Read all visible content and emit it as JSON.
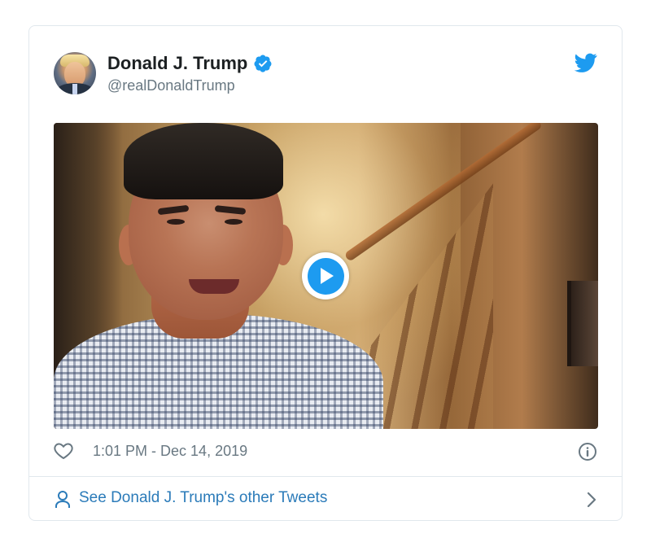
{
  "tweet": {
    "author": {
      "display_name": "Donald J. Trump",
      "handle": "@realDonaldTrump",
      "verified": true,
      "avatar_icon": "profile-photo"
    },
    "timestamp": "1:01 PM - Dec 14, 2019",
    "media": {
      "type": "video",
      "play_icon": "play-button-icon"
    },
    "actions": {
      "like_icon": "heart-icon",
      "info_icon": "info-icon"
    },
    "footer": {
      "label": "See Donald J. Trump's other Tweets",
      "icon": "person-icon",
      "chevron": "chevron-right-icon"
    }
  },
  "colors": {
    "twitter_blue": "#1d9bf0",
    "link_blue": "#2b7bb9",
    "muted_gray": "#697882",
    "border": "#e1e8ed"
  }
}
